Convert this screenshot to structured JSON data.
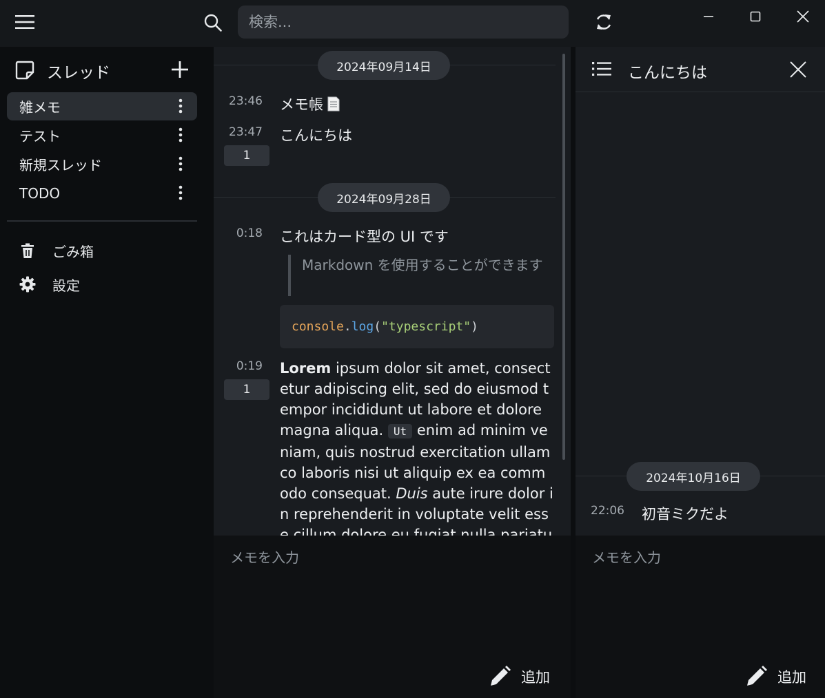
{
  "titlebar": {
    "search_placeholder": "検索..."
  },
  "sidebar": {
    "title": "スレッド",
    "threads": [
      {
        "label": "雑メモ",
        "active": true
      },
      {
        "label": "テスト",
        "active": false
      },
      {
        "label": "新規スレッド",
        "active": false
      },
      {
        "label": "TODO",
        "active": false
      }
    ],
    "trash_label": "ごみ箱",
    "settings_label": "設定"
  },
  "main": {
    "groups": [
      {
        "date": "2024年09月14日",
        "messages": [
          {
            "time": "23:46",
            "text": "メモ帳"
          },
          {
            "time": "23:47",
            "text": "こんにちは",
            "replies": "1"
          }
        ]
      },
      {
        "date": "2024年09月28日",
        "messages": [
          {
            "time": "0:18",
            "text": "これはカード型の UI です",
            "quote": "Markdown を使用することができます",
            "code": {
              "obj": "console",
              "dot": ".",
              "fn": "log",
              "open": "(",
              "str": "\"typescript\"",
              "close": ")"
            }
          },
          {
            "time": "0:19",
            "replies": "1",
            "bold": "Lorem",
            "part1": " ipsum dolor sit amet, consectetur adipiscing elit, sed do eiusmod tempor incididunt ut labore et dolore magna aliqua. ",
            "inline_code": "Ut",
            "part2": " enim ad minim veniam, quis nostrud exercitation ullamco laboris nisi ut aliquip ex ea commodo consequat. ",
            "italic": "Duis",
            "part3": " aute irure dolor in reprehenderit in voluptate velit esse cillum dolore eu fugiat nulla pariatur. Excepteur sint occaecat c"
          }
        ]
      }
    ],
    "composer_placeholder": "メモを入力",
    "add_label": "追加"
  },
  "right": {
    "title": "こんにちは",
    "date": "2024年10月16日",
    "message": {
      "time": "22:06",
      "text": "初音ミクだよ"
    },
    "composer_placeholder": "メモを入力",
    "add_label": "追加"
  },
  "colors": {
    "background": "#0c0e10",
    "panel": "#191c20",
    "active_item": "#2a2e33",
    "pill": "#30343a"
  }
}
